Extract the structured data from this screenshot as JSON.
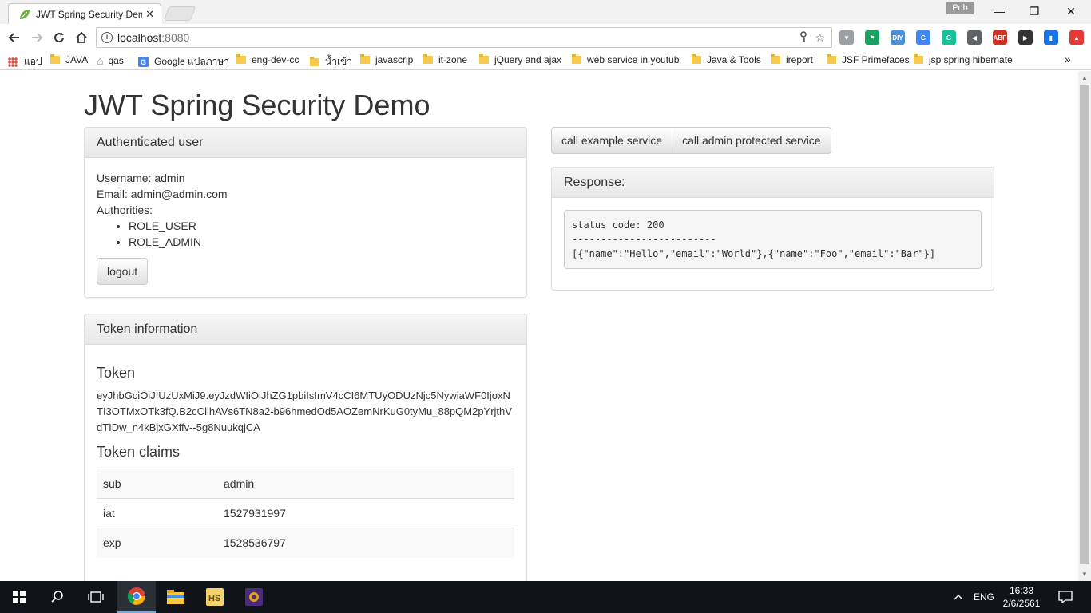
{
  "browser": {
    "tab_title": "JWT Spring Security Dem",
    "tab_close": "✕",
    "profile": "Pob",
    "url_host": "localhost",
    "url_port": ":8080",
    "window_controls": {
      "minimize": "—",
      "restore": "❐",
      "close": "✕"
    },
    "bookmarks": [
      {
        "label": "แอป",
        "icon": "apps-grid-icon"
      },
      {
        "label": "JAVA",
        "icon": "folder-icon"
      },
      {
        "label": "qas",
        "icon": "home-icon"
      },
      {
        "label": "Google แปลภาษา",
        "icon": "google-translate-icon"
      },
      {
        "label": "eng-dev-cc",
        "icon": "folder-icon"
      },
      {
        "label": "น้ำเข้า",
        "icon": "folder-icon"
      },
      {
        "label": "javascrip",
        "icon": "folder-icon"
      },
      {
        "label": "it-zone",
        "icon": "folder-icon"
      },
      {
        "label": "jQuery and ajax",
        "icon": "folder-icon"
      },
      {
        "label": "web service in youtub",
        "icon": "folder-icon"
      },
      {
        "label": "Java & Tools",
        "icon": "folder-icon"
      },
      {
        "label": "ireport",
        "icon": "folder-icon"
      },
      {
        "label": "JSF Primefaces",
        "icon": "folder-icon"
      },
      {
        "label": "jsp spring hibernate",
        "icon": "folder-icon"
      }
    ],
    "bookmarks_overflow": "»",
    "extensions": [
      {
        "name": "vue-devtools-icon",
        "text": "▼",
        "color": "#9aa0a6"
      },
      {
        "name": "flag-icon",
        "text": "⚑",
        "color": "#1aa260"
      },
      {
        "name": "diy-icon",
        "text": "DIY",
        "color": "#4a90d9"
      },
      {
        "name": "google-translate-icon",
        "text": "G",
        "color": "#4285f4"
      },
      {
        "name": "grammarly-icon",
        "text": "G",
        "color": "#15c39a"
      },
      {
        "name": "megaphone-icon",
        "text": "◀",
        "color": "#5f6368"
      },
      {
        "name": "adblock-plus-icon",
        "text": "ABP",
        "color": "#d62d20"
      },
      {
        "name": "youtube-icon",
        "text": "▶",
        "color": "#333333"
      },
      {
        "name": "bookmark-icon",
        "text": "▮",
        "color": "#1a73e8"
      },
      {
        "name": "upload-icon",
        "text": "▲",
        "color": "#e53935"
      }
    ]
  },
  "page": {
    "title": "JWT Spring Security Demo",
    "user_panel": {
      "heading": "Authenticated user",
      "username": "Username: admin",
      "email": "Email: admin@admin.com",
      "authorities_label": "Authorities:",
      "authorities": [
        "ROLE_USER",
        "ROLE_ADMIN"
      ],
      "logout_label": "logout"
    },
    "token_panel": {
      "heading": "Token information",
      "token_heading": "Token",
      "token": "eyJhbGciOiJIUzUxMiJ9.eyJzdWIiOiJhZG1pbiIsImV4cCI6MTUyODUzNjc5NywiaWF0IjoxNTI3OTMxOTk3fQ.B2cClihAVs6TN8a2-b96hmedOd5AOZemNrKuG0tyMu_88pQM2pYrjthVdTIDw_n4kBjxGXffv--5g8NuukqjCA",
      "claims_heading": "Token claims",
      "claims": [
        {
          "key": "sub",
          "value": "admin"
        },
        {
          "key": "iat",
          "value": "1527931997"
        },
        {
          "key": "exp",
          "value": "1528536797"
        }
      ]
    },
    "actions": {
      "example_service_label": "call example service",
      "admin_service_label": "call admin protected service"
    },
    "response_panel": {
      "heading": "Response:",
      "status_line": "status code: 200",
      "separator": "-------------------------",
      "body": "[{\"name\":\"Hello\",\"email\":\"World\"},{\"name\":\"Foo\",\"email\":\"Bar\"}]"
    }
  },
  "taskbar": {
    "language": "ENG",
    "time": "16:33",
    "date": "2/6/2561"
  }
}
